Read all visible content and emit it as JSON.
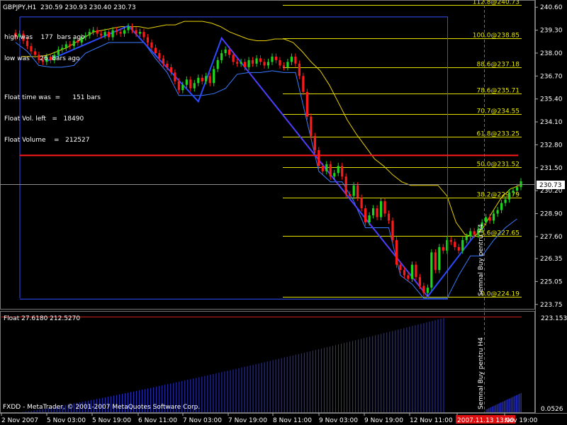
{
  "window": {
    "header": "GBPJPY,H1  230.59 230.93 230.40 230.73",
    "footer": "FXDD - MetaTrader, © 2001-2007 MetaQuotes Software Corp."
  },
  "info_panel": {
    "lines": [
      "high was    177  bars ago",
      "low was     26  bars ago",
      "",
      "Float time was  =      151 bars",
      "Float Vol. left   =   18490",
      "Float Volume    =   212527"
    ]
  },
  "chart_data": {
    "type": "candlestick",
    "symbol": "GBPJPY",
    "timeframe": "H1",
    "ohlc_last": {
      "open": 230.59,
      "high": 230.93,
      "low": 230.4,
      "close": 230.73
    },
    "current_price": 230.73,
    "price_range": [
      223.5,
      240.85
    ],
    "price_ticks": [
      "240.60",
      "239.30",
      "238.00",
      "236.70",
      "235.40",
      "234.10",
      "232.80",
      "231.50",
      "230.20",
      "228.90",
      "227.60",
      "226.35",
      "225.05",
      "223.75"
    ],
    "time_labels": [
      "2 Nov 2007",
      "5 Nov 03:00",
      "5 Nov 19:00",
      "6 Nov 11:00",
      "7 Nov 03:00",
      "7 Nov 19:00",
      "8 Nov 11:00",
      "9 Nov 03:00",
      "9 Nov 19:00",
      "12 Nov 11:00",
      "2007.11.13 13:00",
      "Nov 19:00"
    ],
    "highlighted_time": "2007.11.13 13:00",
    "fibonacci_levels": [
      {
        "label": "112.8@240.73",
        "price": 240.73
      },
      {
        "label": "100.0@238.85",
        "price": 238.85
      },
      {
        "label": "88.6@237.18",
        "price": 237.18
      },
      {
        "label": "78.6@235.71",
        "price": 235.71
      },
      {
        "label": "70.7@234.55",
        "price": 234.55
      },
      {
        "label": "61.8@233.25",
        "price": 233.25
      },
      {
        "label": "50.0@231.52",
        "price": 231.52
      },
      {
        "label": "38.2@229.79",
        "price": 229.79
      },
      {
        "label": "23.6@227.65",
        "price": 227.65
      },
      {
        "label": "0.0@224.19",
        "price": 224.19
      }
    ],
    "vertical_annotation": "Semnal Buy pentru H4",
    "closes": [
      238.9,
      239.1,
      238.7,
      238.4,
      238.1,
      237.9,
      237.6,
      237.5,
      237.8,
      237.6,
      237.9,
      238.2,
      238.3,
      238.5,
      238.4,
      238.7,
      238.6,
      238.9,
      239.0,
      239.2,
      239.3,
      239.1,
      239.0,
      239.2,
      238.9,
      239.3,
      239.2,
      239.1,
      239.3,
      239.5,
      239.3,
      239.1,
      239.2,
      238.9,
      238.6,
      238.3,
      238.0,
      237.7,
      237.4,
      237.2,
      236.9,
      236.4,
      235.9,
      236.2,
      236.5,
      236.0,
      236.3,
      236.6,
      236.4,
      236.7,
      236.3,
      237.1,
      237.6,
      238.0,
      238.2,
      237.9,
      237.5,
      237.4,
      237.5,
      237.2,
      237.6,
      237.4,
      237.7,
      237.5,
      237.3,
      237.5,
      237.8,
      237.6,
      237.3,
      237.2,
      237.5,
      237.8,
      237.4,
      236.7,
      235.8,
      234.4,
      233.3,
      232.5,
      231.6,
      231.3,
      231.7,
      231.0,
      231.2,
      231.6,
      231.0,
      230.0,
      229.9,
      230.5,
      229.8,
      229.2,
      228.4,
      228.8,
      229.2,
      228.7,
      229.6,
      228.9,
      228.5,
      227.4,
      226.0,
      225.7,
      225.4,
      225.2,
      226.0,
      225.3,
      224.8,
      224.4,
      224.7,
      226.7,
      225.7,
      227.0,
      226.8,
      227.4,
      227.3,
      227.0,
      226.8,
      227.4,
      227.6,
      227.9,
      227.7,
      228.0,
      228.4,
      228.7,
      228.5,
      228.9,
      229.1,
      229.5,
      229.7,
      230.1,
      230.2,
      230.4,
      230.73
    ],
    "channel_line": [
      237.8,
      237.8,
      237.8,
      237.9,
      238.1,
      238.3,
      238.6,
      238.9,
      239.2,
      239.3,
      239.4,
      239.5,
      239.5,
      239.5,
      239.4,
      239.5,
      239.6,
      239.6,
      239.8,
      239.8,
      239.8,
      239.7,
      239.5,
      239.2,
      239.0,
      238.8,
      238.7,
      238.7,
      238.8,
      238.8,
      238.6,
      238.1,
      237.5,
      237.0,
      236.2,
      235.2,
      234.2,
      233.4,
      232.7,
      232.0,
      231.6,
      231.1,
      230.7,
      230.5,
      230.5,
      230.5,
      230.5,
      229.9,
      228.4,
      227.7,
      227.6,
      228.1,
      229.0,
      229.8,
      230.3,
      230.5
    ],
    "float_indicator": {
      "label": "Float 27.6180 212.5270",
      "scale_labels": [
        "223.1533",
        "0.0526"
      ],
      "histogram": [
        0.1,
        0.22,
        0.38,
        0.56,
        0.76,
        1.0,
        0.08,
        0.16
      ]
    }
  }
}
